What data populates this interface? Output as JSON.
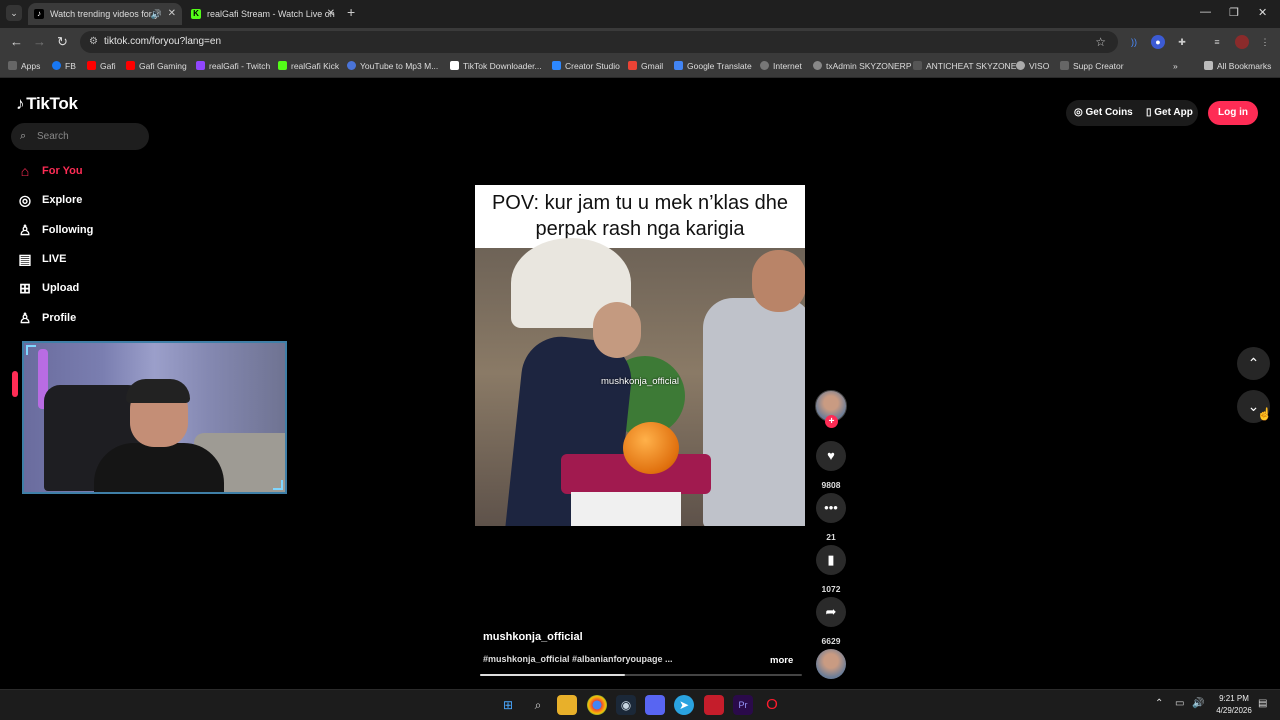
{
  "browser": {
    "tabs": [
      {
        "title": "Watch trending videos for y",
        "active": true
      },
      {
        "title": "realGafi Stream - Watch Live on",
        "active": false
      }
    ],
    "url": "tiktok.com/foryou?lang=en",
    "bookmarks": [
      "Apps",
      "FB",
      "Gafi",
      "Gafi Gaming",
      "realGafi - Twitch",
      "realGafi Kick",
      "YouTube to Mp3 M...",
      "TikTok Downloader...",
      "Creator Studio",
      "Gmail",
      "Google Translate",
      "Internet",
      "txAdmin SKYZONERP",
      "ANTICHEAT SKYZONE",
      "VISO",
      "Supp Creator",
      "All Bookmarks"
    ]
  },
  "tiktok": {
    "logo": "TikTok",
    "search_placeholder": "Search",
    "menu": [
      "For You",
      "Explore",
      "Following",
      "LIVE",
      "Upload",
      "Profile"
    ],
    "get_coins": "Get Coins",
    "get_app": "Get App",
    "login": "Log in"
  },
  "video": {
    "caption_line1": "POV: kur jam tu u mek n’klas dhe",
    "caption_line2": "perpak rash nga karigia",
    "watermark": "mushkonja_official",
    "author": "mushkonja_official",
    "tags": "#mushkonja_official #albanianforyoupage ...",
    "more": "more",
    "likes": "9808",
    "comments": "21",
    "saves": "1072",
    "shares": "6629",
    "progress": 0.45
  },
  "taskbar": {
    "time": "9:21 PM",
    "date": "4/29/2026"
  }
}
